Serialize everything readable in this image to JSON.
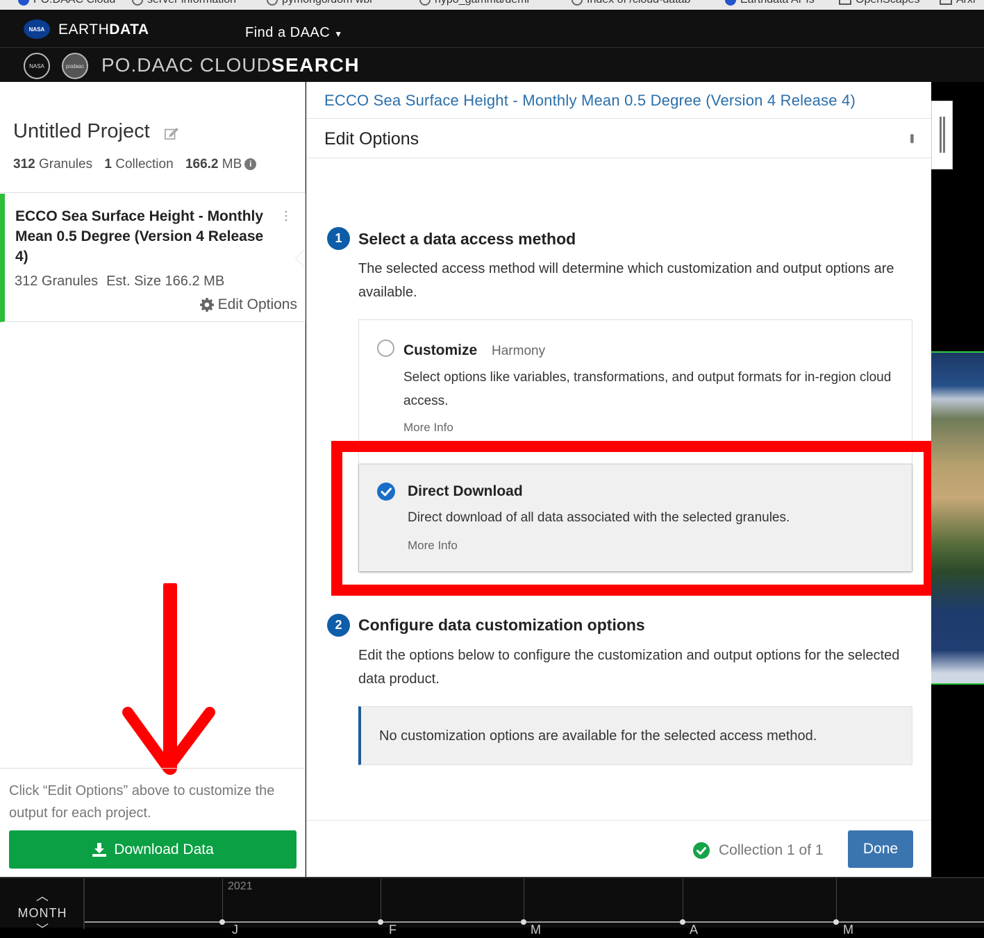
{
  "browser": {
    "bookmarks": [
      "PO.DAAC Cloud",
      "server information",
      "pymongo/dom wbi",
      "hypo_gamma/demi",
      "Index of /cloud-datab",
      "Earthdata APIs",
      "OpenScapes",
      "Arxi"
    ]
  },
  "earthdata": {
    "logo_text": "NASA",
    "title_light": "EARTH",
    "title_bold": "DATA",
    "find_daac": "Find a DAAC"
  },
  "podaac": {
    "nasa_logo": "NASA",
    "podaac_logo": "podaac",
    "title_light": "PO.DAAC CLOUD",
    "title_bold": "SEARCH"
  },
  "project": {
    "name": "Untitled Project",
    "granules_count": "312",
    "granules_label": "Granules",
    "collections_count": "1",
    "collections_label": "Collection",
    "size_value": "166.2",
    "size_unit": "MB"
  },
  "collection": {
    "title": "ECCO Sea Surface Height - Monthly Mean 0.5 Degree (Version 4 Release 4)",
    "granules": "312 Granules",
    "est_size": "Est. Size 166.2 MB",
    "edit_options": "Edit Options"
  },
  "sidebar_footer": {
    "hint": "Click “Edit Options” above to customize the output for each project.",
    "download_label": "Download Data"
  },
  "panel": {
    "collection_title": "ECCO Sea Surface Height - Monthly Mean 0.5 Degree (Version 4 Release 4)",
    "heading": "Edit Options",
    "step1": {
      "number": "1",
      "title": "Select a data access method",
      "description": "The selected access method will determine which customization and output options are available."
    },
    "methods": {
      "customize": {
        "title": "Customize",
        "subtitle": "Harmony",
        "description": "Select options like variables, transformations, and output formats for in-region cloud access.",
        "more_info": "More Info",
        "selected": false
      },
      "direct_download": {
        "title": "Direct Download",
        "description": "Direct download of all data associated with the selected granules.",
        "more_info": "More Info",
        "selected": true
      }
    },
    "step2": {
      "number": "2",
      "title": "Configure data customization options",
      "description": "Edit the options below to configure the customization and output options for the selected data product."
    },
    "no_options": "No customization options are available for the selected access method.",
    "footer": {
      "collection_status": "Collection 1 of 1",
      "done_label": "Done"
    }
  },
  "timeline": {
    "resolution": "MONTH",
    "year": "2021",
    "months": [
      "J",
      "F",
      "M",
      "A",
      "M"
    ]
  },
  "colors": {
    "download_green": "#0aa043",
    "link_blue": "#2a6faa",
    "step_blue": "#0e5da8",
    "done_blue": "#3a75b0",
    "annotation_red": "#ff0000",
    "selected_bar_green": "#2ebd3a"
  }
}
